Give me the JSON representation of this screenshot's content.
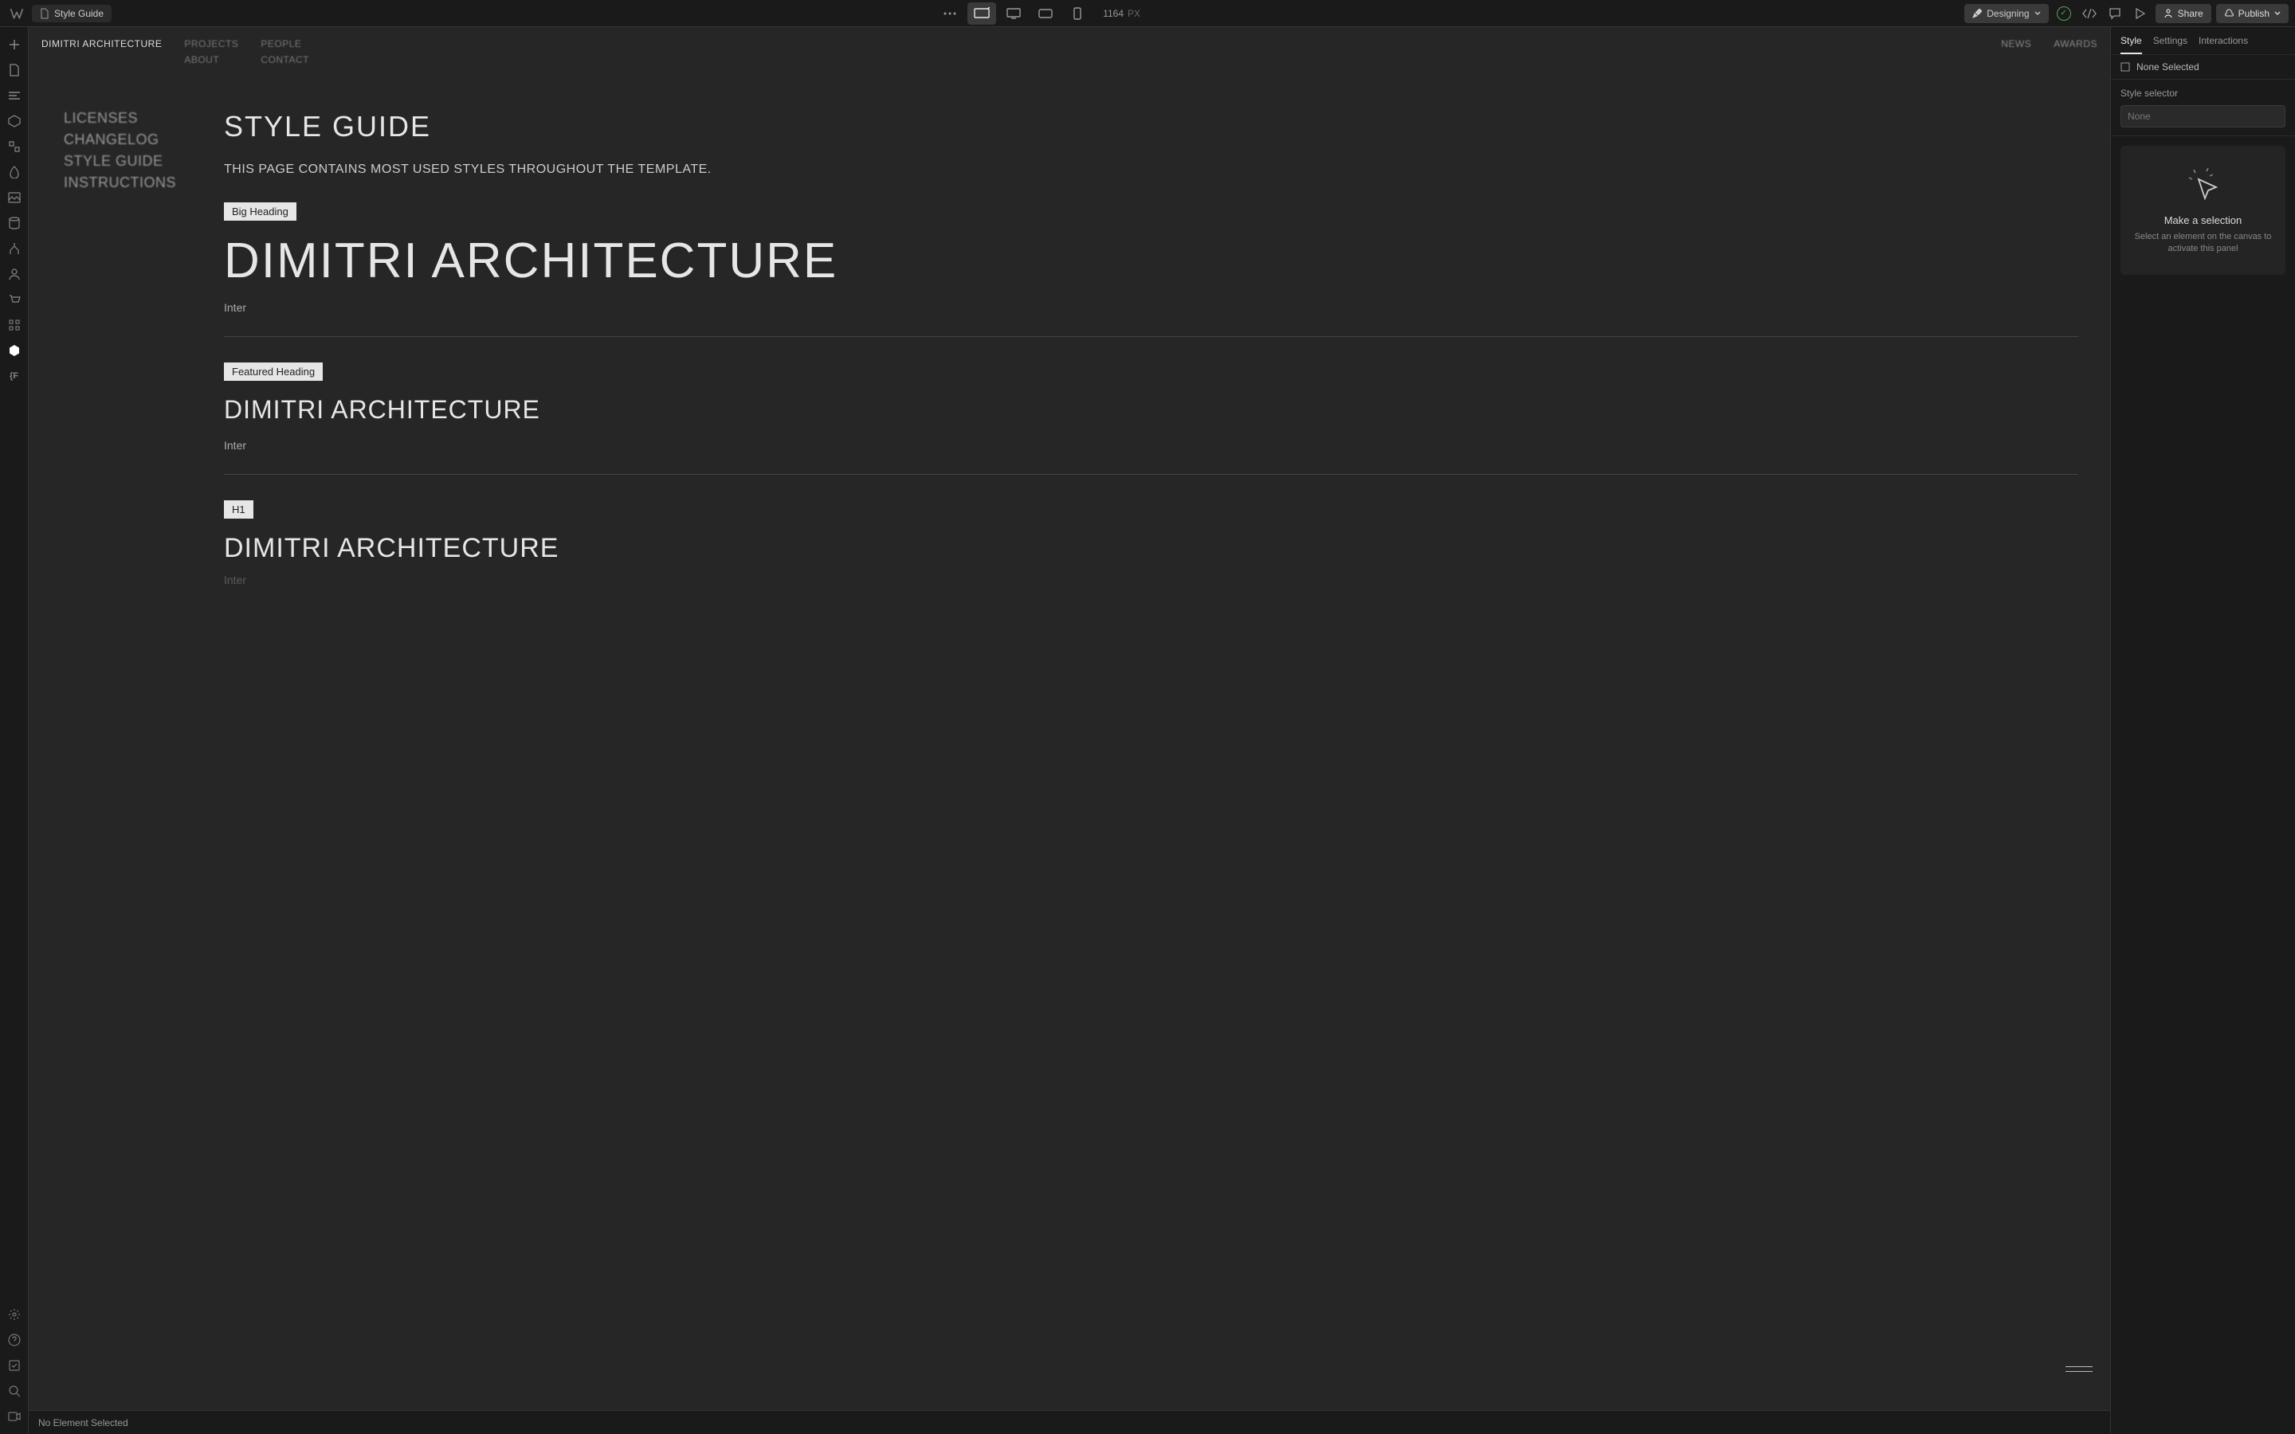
{
  "topbar": {
    "page_name": "Style Guide",
    "viewport_width": "1164",
    "viewport_unit": "PX",
    "mode_label": "Designing",
    "share_label": "Share",
    "publish_label": "Publish"
  },
  "site": {
    "brand": "DIMITRI ARCHITECTURE",
    "nav1": [
      "PROJECTS",
      "ABOUT"
    ],
    "nav2": [
      "PEOPLE",
      "CONTACT"
    ],
    "nav_right": [
      "NEWS",
      "AWARDS"
    ],
    "sidebar": [
      "LICENSES",
      "CHANGELOG",
      "STYLE GUIDE",
      "INSTRUCTIONS"
    ],
    "title": "STYLE GUIDE",
    "description": "THIS PAGE CONTAINS MOST USED STYLES THROUGHOUT THE TEMPLATE.",
    "sections": [
      {
        "chip": "Big Heading",
        "sample": "DIMITRI ARCHITECTURE",
        "font": "Inter"
      },
      {
        "chip": "Featured Heading",
        "sample": "DIMITRI ARCHITECTURE",
        "font": "Inter"
      },
      {
        "chip": "H1",
        "sample": "DIMITRI ARCHITECTURE",
        "font": "Inter"
      }
    ]
  },
  "statusbar": {
    "text": "No Element Selected"
  },
  "right_panel": {
    "tabs": [
      "Style",
      "Settings",
      "Interactions"
    ],
    "none_selected": "None Selected",
    "selector_label": "Style selector",
    "selector_value": "None",
    "placeholder_title": "Make a selection",
    "placeholder_sub": "Select an element on the canvas to activate this panel"
  }
}
